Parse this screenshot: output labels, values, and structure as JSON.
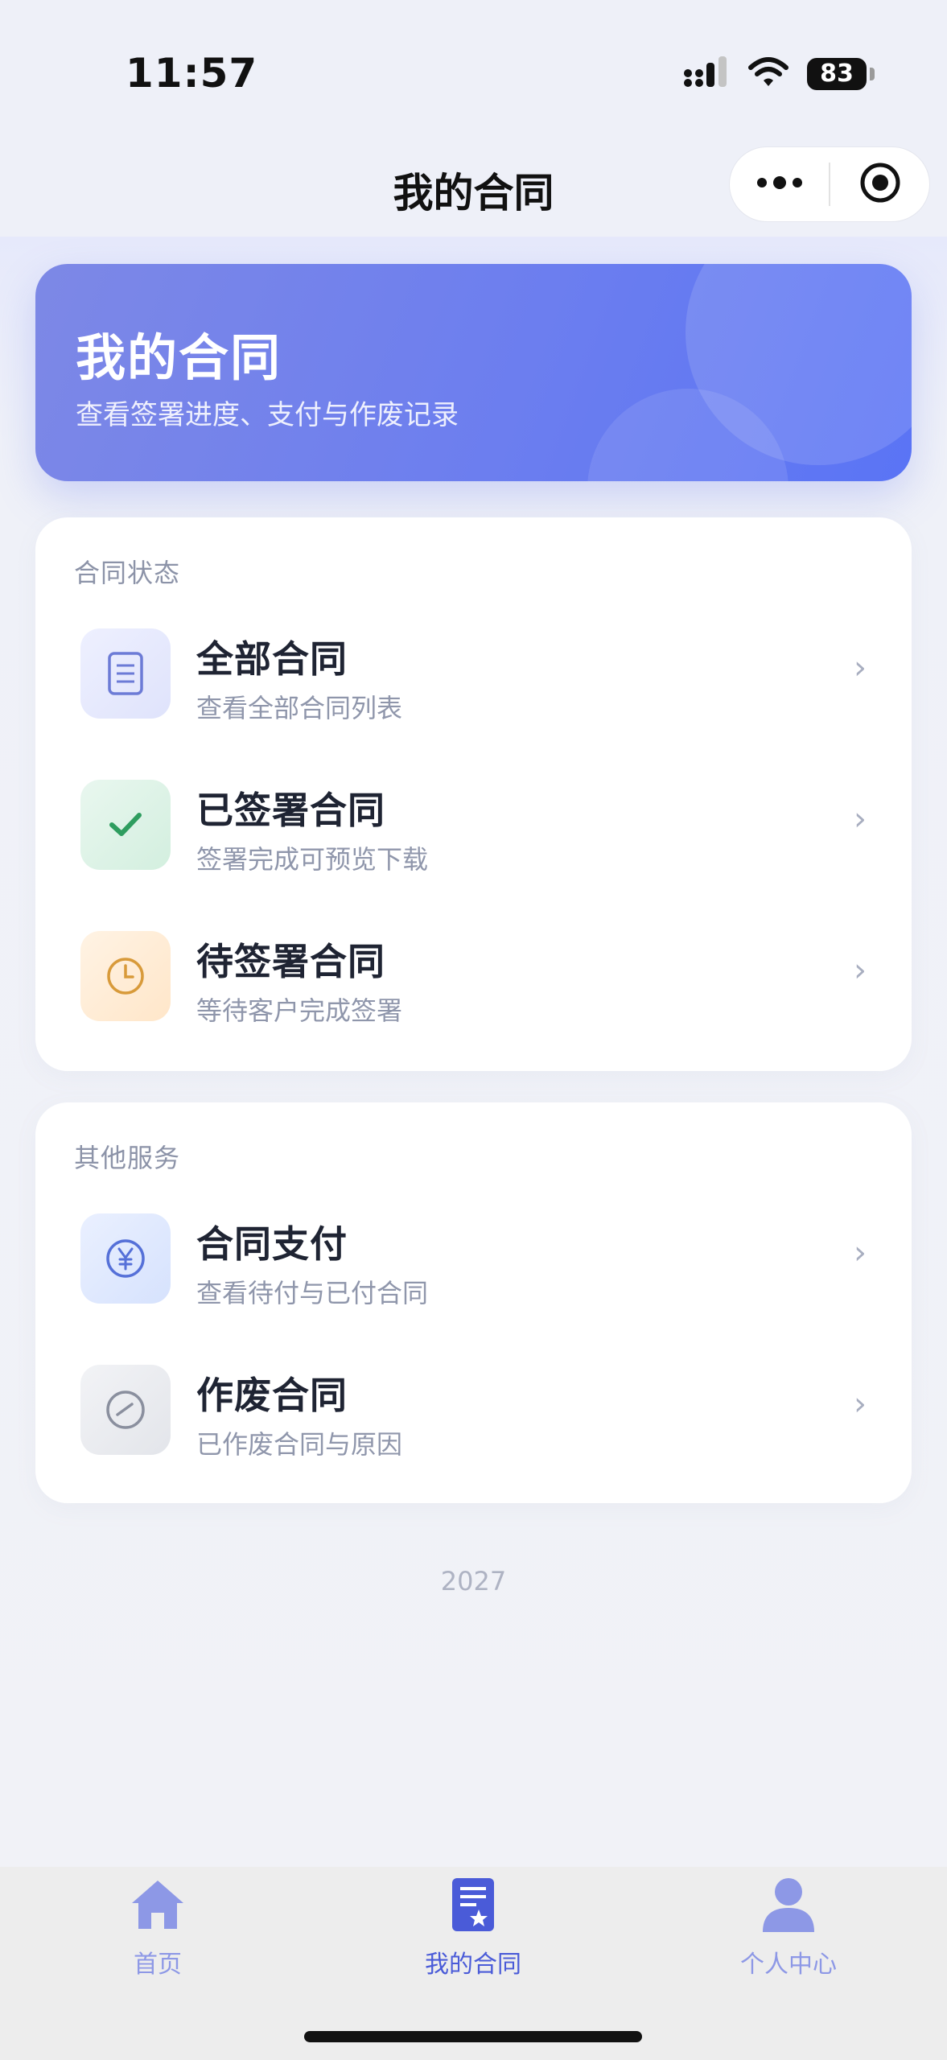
{
  "status_bar": {
    "time": "11:57",
    "battery": "83"
  },
  "nav": {
    "title": "我的合同"
  },
  "banner": {
    "title": "我的合同",
    "subtitle": "查看签署进度、支付与作废记录"
  },
  "sections": [
    {
      "label": "合同状态",
      "items": [
        {
          "title": "全部合同",
          "subtitle": "查看全部合同列表",
          "icon": "document-icon"
        },
        {
          "title": "已签署合同",
          "subtitle": "签署完成可预览下载",
          "icon": "check-icon"
        },
        {
          "title": "待签署合同",
          "subtitle": "等待客户完成签署",
          "icon": "clock-icon"
        }
      ]
    },
    {
      "label": "其他服务",
      "items": [
        {
          "title": "合同支付",
          "subtitle": "查看待付与已付合同",
          "icon": "yen-icon"
        },
        {
          "title": "作废合同",
          "subtitle": "已作废合同与原因",
          "icon": "void-icon"
        }
      ]
    }
  ],
  "footer": {
    "year": "2027"
  },
  "tabbar": {
    "items": [
      {
        "label": "首页",
        "icon": "home-icon",
        "active": false
      },
      {
        "label": "我的合同",
        "icon": "contract-icon",
        "active": true
      },
      {
        "label": "个人中心",
        "icon": "user-icon",
        "active": false
      }
    ]
  },
  "colors": {
    "accent": "#4a5bd8",
    "banner_start": "#7d88e6",
    "banner_end": "#5a74f5",
    "signed": "#2e9d5f",
    "pending": "#d89a3a",
    "tab_inactive": "#8d98e6"
  }
}
